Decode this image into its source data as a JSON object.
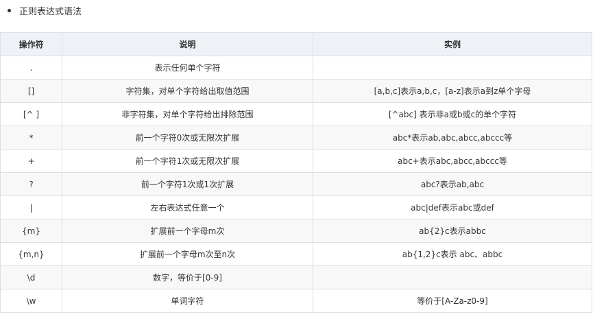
{
  "bullet": {
    "text": "正则表达式语法"
  },
  "table": {
    "headers": [
      "操作符",
      "说明",
      "实例"
    ],
    "rows": [
      {
        "op": ".",
        "desc": "表示任何单个字符",
        "example": ""
      },
      {
        "op": "[]",
        "desc": "字符集，对单个字符给出取值范围",
        "example": "[a,b,c]表示a,b,c，[a-z]表示a到z单个字母"
      },
      {
        "op": "[^ ]",
        "desc": "非字符集，对单个字符给出排除范围",
        "example": "[^abc] 表示非a或b或c的单个字符"
      },
      {
        "op": "*",
        "desc": "前一个字符0次或无限次扩展",
        "example": "abc*表示ab,abc,abcc,abccc等"
      },
      {
        "op": "+",
        "desc": "前一个字符1次或无限次扩展",
        "example": "abc+表示abc,abcc,abccc等"
      },
      {
        "op": "?",
        "desc": "前一个字符1次或1次扩展",
        "example": "abc?表示ab,abc"
      },
      {
        "op": "|",
        "desc": "左右表达式任意一个",
        "example": "abc|def表示abc或def"
      },
      {
        "op": "{m}",
        "desc": "扩展前一个字母m次",
        "example": "ab{2}c表示abbc"
      },
      {
        "op": "{m,n}",
        "desc": "扩展前一个字母m次至n次",
        "example": "ab{1,2}c表示 abc、abbc"
      },
      {
        "op": "\\d",
        "desc": "数字，等价于[0-9]",
        "example": ""
      },
      {
        "op": "\\w",
        "desc": "单词字符",
        "example": "等价于[A-Za-z0-9]"
      }
    ]
  }
}
